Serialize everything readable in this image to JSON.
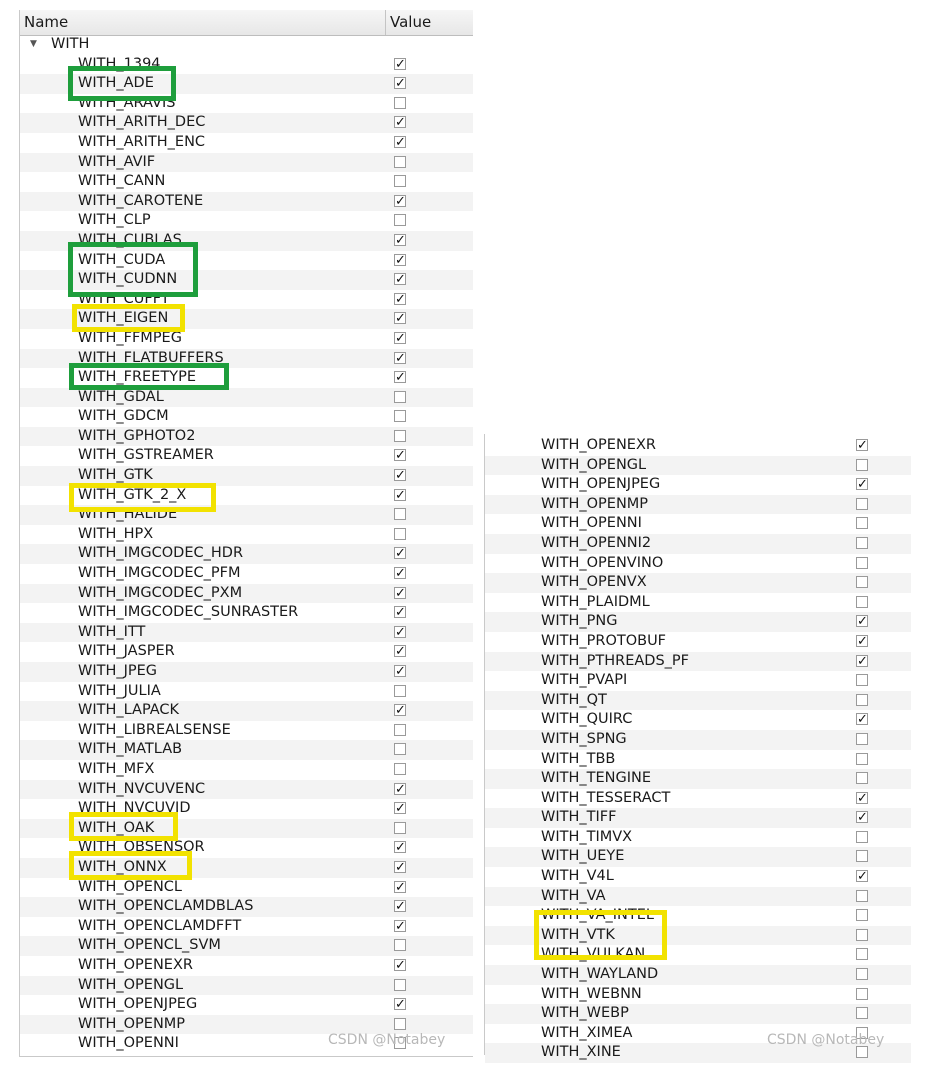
{
  "header": {
    "name_col": "Name",
    "value_col": "Value"
  },
  "group_label": "WITH",
  "left_rows": [
    {
      "name": "WITH_1394",
      "checked": true
    },
    {
      "name": "WITH_ADE",
      "checked": true
    },
    {
      "name": "WITH_ARAVIS",
      "checked": false
    },
    {
      "name": "WITH_ARITH_DEC",
      "checked": true
    },
    {
      "name": "WITH_ARITH_ENC",
      "checked": true
    },
    {
      "name": "WITH_AVIF",
      "checked": false
    },
    {
      "name": "WITH_CANN",
      "checked": false
    },
    {
      "name": "WITH_CAROTENE",
      "checked": true
    },
    {
      "name": "WITH_CLP",
      "checked": false
    },
    {
      "name": "WITH_CUBLAS",
      "checked": true
    },
    {
      "name": "WITH_CUDA",
      "checked": true
    },
    {
      "name": "WITH_CUDNN",
      "checked": true
    },
    {
      "name": "WITH_CUFFT",
      "checked": true
    },
    {
      "name": "WITH_EIGEN",
      "checked": true
    },
    {
      "name": "WITH_FFMPEG",
      "checked": true
    },
    {
      "name": "WITH_FLATBUFFERS",
      "checked": true
    },
    {
      "name": "WITH_FREETYPE",
      "checked": true
    },
    {
      "name": "WITH_GDAL",
      "checked": false
    },
    {
      "name": "WITH_GDCM",
      "checked": false
    },
    {
      "name": "WITH_GPHOTO2",
      "checked": false
    },
    {
      "name": "WITH_GSTREAMER",
      "checked": true
    },
    {
      "name": "WITH_GTK",
      "checked": true
    },
    {
      "name": "WITH_GTK_2_X",
      "checked": true
    },
    {
      "name": "WITH_HALIDE",
      "checked": false
    },
    {
      "name": "WITH_HPX",
      "checked": false
    },
    {
      "name": "WITH_IMGCODEC_HDR",
      "checked": true
    },
    {
      "name": "WITH_IMGCODEC_PFM",
      "checked": true
    },
    {
      "name": "WITH_IMGCODEC_PXM",
      "checked": true
    },
    {
      "name": "WITH_IMGCODEC_SUNRASTER",
      "checked": true
    },
    {
      "name": "WITH_ITT",
      "checked": true
    },
    {
      "name": "WITH_JASPER",
      "checked": true
    },
    {
      "name": "WITH_JPEG",
      "checked": true
    },
    {
      "name": "WITH_JULIA",
      "checked": false
    },
    {
      "name": "WITH_LAPACK",
      "checked": true
    },
    {
      "name": "WITH_LIBREALSENSE",
      "checked": false
    },
    {
      "name": "WITH_MATLAB",
      "checked": false
    },
    {
      "name": "WITH_MFX",
      "checked": false
    },
    {
      "name": "WITH_NVCUVENC",
      "checked": true
    },
    {
      "name": "WITH_NVCUVID",
      "checked": true
    },
    {
      "name": "WITH_OAK",
      "checked": false
    },
    {
      "name": "WITH_OBSENSOR",
      "checked": true
    },
    {
      "name": "WITH_ONNX",
      "checked": true
    },
    {
      "name": "WITH_OPENCL",
      "checked": true
    },
    {
      "name": "WITH_OPENCLAMDBLAS",
      "checked": true
    },
    {
      "name": "WITH_OPENCLAMDFFT",
      "checked": true
    },
    {
      "name": "WITH_OPENCL_SVM",
      "checked": false
    },
    {
      "name": "WITH_OPENEXR",
      "checked": true
    },
    {
      "name": "WITH_OPENGL",
      "checked": false
    },
    {
      "name": "WITH_OPENJPEG",
      "checked": true
    },
    {
      "name": "WITH_OPENMP",
      "checked": false
    },
    {
      "name": "WITH_OPENNI",
      "checked": false
    }
  ],
  "right_rows": [
    {
      "name": "WITH_OPENEXR",
      "checked": true
    },
    {
      "name": "WITH_OPENGL",
      "checked": false
    },
    {
      "name": "WITH_OPENJPEG",
      "checked": true
    },
    {
      "name": "WITH_OPENMP",
      "checked": false
    },
    {
      "name": "WITH_OPENNI",
      "checked": false
    },
    {
      "name": "WITH_OPENNI2",
      "checked": false
    },
    {
      "name": "WITH_OPENVINO",
      "checked": false
    },
    {
      "name": "WITH_OPENVX",
      "checked": false
    },
    {
      "name": "WITH_PLAIDML",
      "checked": false
    },
    {
      "name": "WITH_PNG",
      "checked": true
    },
    {
      "name": "WITH_PROTOBUF",
      "checked": true
    },
    {
      "name": "WITH_PTHREADS_PF",
      "checked": true
    },
    {
      "name": "WITH_PVAPI",
      "checked": false
    },
    {
      "name": "WITH_QT",
      "checked": false
    },
    {
      "name": "WITH_QUIRC",
      "checked": true
    },
    {
      "name": "WITH_SPNG",
      "checked": false
    },
    {
      "name": "WITH_TBB",
      "checked": false
    },
    {
      "name": "WITH_TENGINE",
      "checked": false
    },
    {
      "name": "WITH_TESSERACT",
      "checked": true
    },
    {
      "name": "WITH_TIFF",
      "checked": true
    },
    {
      "name": "WITH_TIMVX",
      "checked": false
    },
    {
      "name": "WITH_UEYE",
      "checked": false
    },
    {
      "name": "WITH_V4L",
      "checked": true
    },
    {
      "name": "WITH_VA",
      "checked": false
    },
    {
      "name": "WITH_VA_INTEL",
      "checked": false
    },
    {
      "name": "WITH_VTK",
      "checked": false
    },
    {
      "name": "WITH_VULKAN",
      "checked": false
    },
    {
      "name": "WITH_WAYLAND",
      "checked": false
    },
    {
      "name": "WITH_WEBNN",
      "checked": false
    },
    {
      "name": "WITH_WEBP",
      "checked": false
    },
    {
      "name": "WITH_XIMEA",
      "checked": false
    },
    {
      "name": "WITH_XINE",
      "checked": false
    }
  ],
  "check_glyph": "✓",
  "watermark": "CSDN @Notabey",
  "colors": {
    "green_highlight": "#1e9e3c",
    "yellow_highlight": "#f2e200"
  },
  "icons": {
    "group_toggle": "expand-triangle-icon"
  }
}
